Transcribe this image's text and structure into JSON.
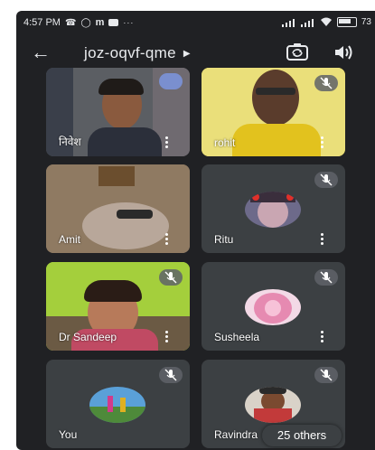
{
  "status_bar": {
    "time": "4:57 PM",
    "notif_icons": [
      "missed-call-icon",
      "whatsapp-icon",
      "m-app-icon",
      "messenger-icon",
      "more-dots-icon"
    ],
    "battery_text": "73"
  },
  "header": {
    "meeting_code": "joz-oqvf-qme"
  },
  "participants": [
    {
      "name": "निवेश",
      "muted": false,
      "video": true
    },
    {
      "name": "rohit",
      "muted": true,
      "video": true
    },
    {
      "name": "Amit",
      "muted": false,
      "video": true
    },
    {
      "name": "Ritu",
      "muted": true,
      "video": false
    },
    {
      "name": "Dr Sandeep",
      "muted": true,
      "video": true
    },
    {
      "name": "Susheela",
      "muted": true,
      "video": false
    },
    {
      "name": "You",
      "muted": true,
      "video": false
    },
    {
      "name": "Ravindra",
      "muted": true,
      "video": false
    }
  ],
  "others_chip": "25 others",
  "colors": {
    "background": "#202124",
    "tile": "#3c4043",
    "text": "#e8eaed"
  }
}
